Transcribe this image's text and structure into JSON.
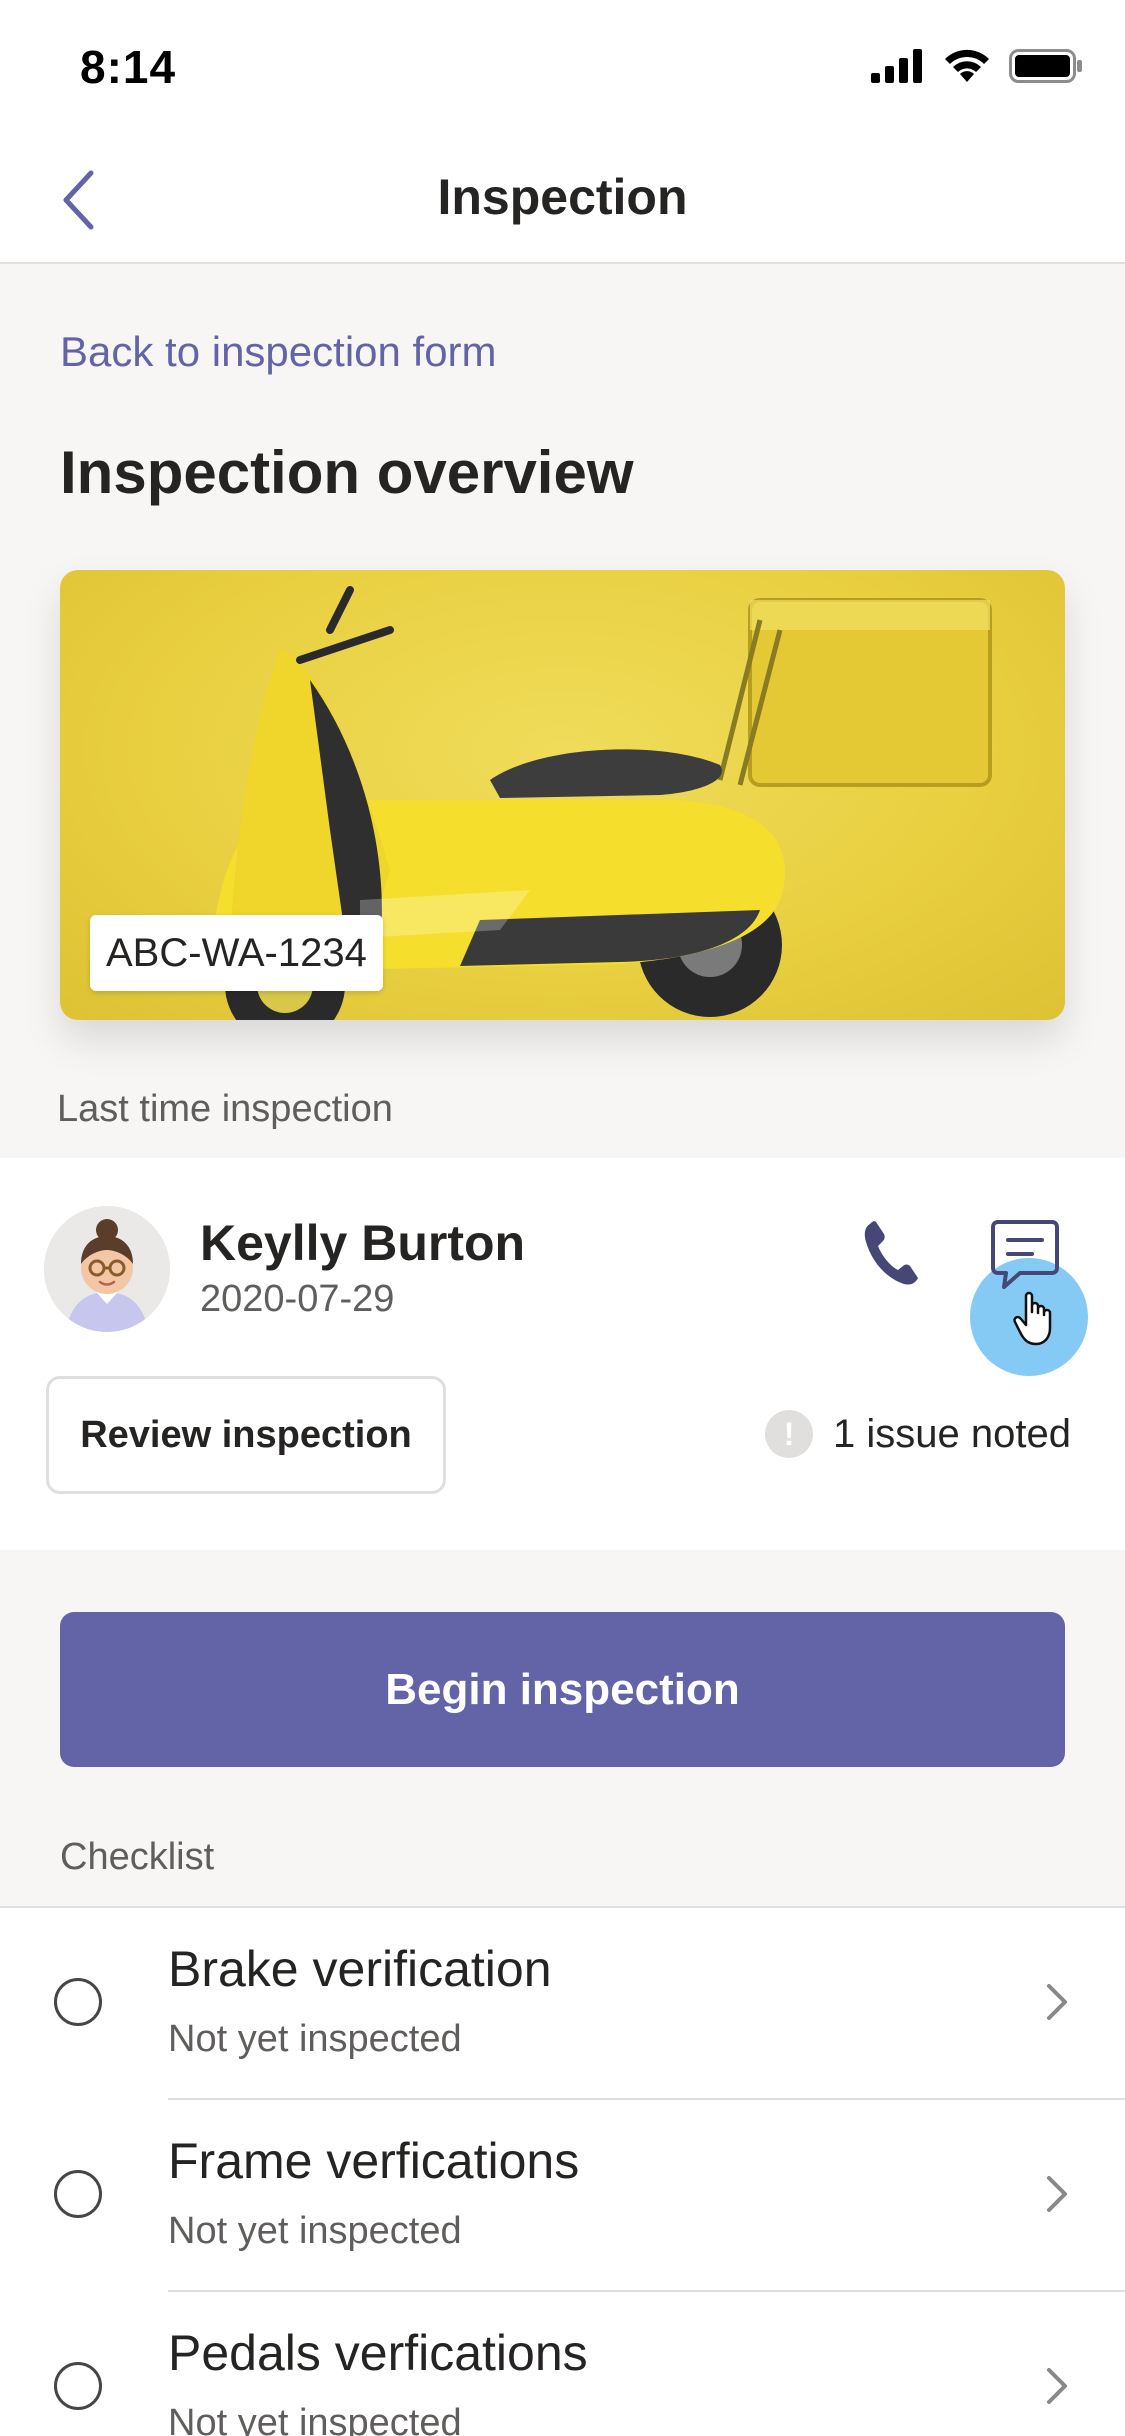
{
  "status_bar": {
    "time": "8:14"
  },
  "nav": {
    "title": "Inspection"
  },
  "back_link": "Back to inspection form",
  "section_title": "Inspection overview",
  "vehicle": {
    "plate": "ABC-WA-1234"
  },
  "last_inspection": {
    "label": "Last time inspection",
    "name": "Keylly Burton",
    "date": "2020-07-29",
    "review_button": "Review inspection",
    "issue_text": "1 issue noted",
    "issue_icon": "!"
  },
  "begin_button": "Begin inspection",
  "checklist": {
    "label": "Checklist",
    "items": [
      {
        "title": "Brake verification",
        "status": "Not yet inspected"
      },
      {
        "title": "Frame verfications",
        "status": "Not yet inspected"
      },
      {
        "title": "Pedals verfications",
        "status": "Not yet inspected"
      }
    ]
  },
  "colors": {
    "accent": "#6264a7",
    "tap_indicator": "#5cb8f0",
    "hero_background": "#e8cf3f"
  }
}
